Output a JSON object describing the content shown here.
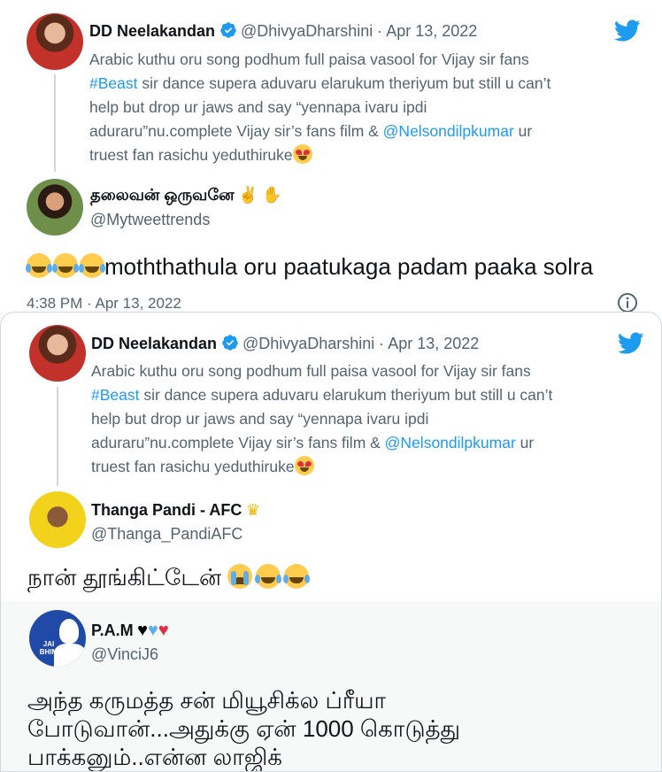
{
  "quoted_tweet": {
    "author_name": "DD Neelakandan",
    "author_handle": "@DhivyaDharshini",
    "dot": "·",
    "date": "Apr 13, 2022",
    "text_parts": [
      "Arabic kuthu oru song podhum full paisa vasool for Vijay sir fans",
      "#Beast",
      " sir dance supera aduvaru elarukum theriyum but still u can’t",
      "help but drop ur jaws and say “yennapa ivaru ipdi",
      "aduraru”nu.complete Vijay sir’s fans film & ",
      "@Nelsondilpkumar",
      " ur",
      "truest fan rasichu yeduthiruke"
    ]
  },
  "reply1": {
    "author_name": "தலைவன் ஒருவனே",
    "author_handle": "@Mytweettrends",
    "text": "moththathula oru paatukaga padam paaka solra",
    "time": "4:38 PM · Apr 13, 2022"
  },
  "reply2": {
    "author_name": "Thanga Pandi - AFC",
    "author_handle": "@Thanga_PandiAFC",
    "text": "நான் தூங்கிட்டேன்"
  },
  "reply3": {
    "author_name": "P.A.M",
    "author_handle": "@VinciJ6",
    "text_lines": [
      "அந்த கருமத்த சன் மியூசிக்ல ப்ரீயா",
      "போடுவான்...அதுக்கு ஏன் 1000 கொடுத்து",
      "பாக்கனும்..என்ன லாஜிக்"
    ],
    "avatar_text": "JAI BHIM"
  },
  "colors": {
    "accent": "#1d9bf0",
    "text": "#0f1419",
    "muted": "#536471",
    "line": "#cfd9de"
  },
  "icons": {
    "twitter": "twitter-bird-icon",
    "verified": "verified-badge-icon",
    "info": "info-icon"
  }
}
